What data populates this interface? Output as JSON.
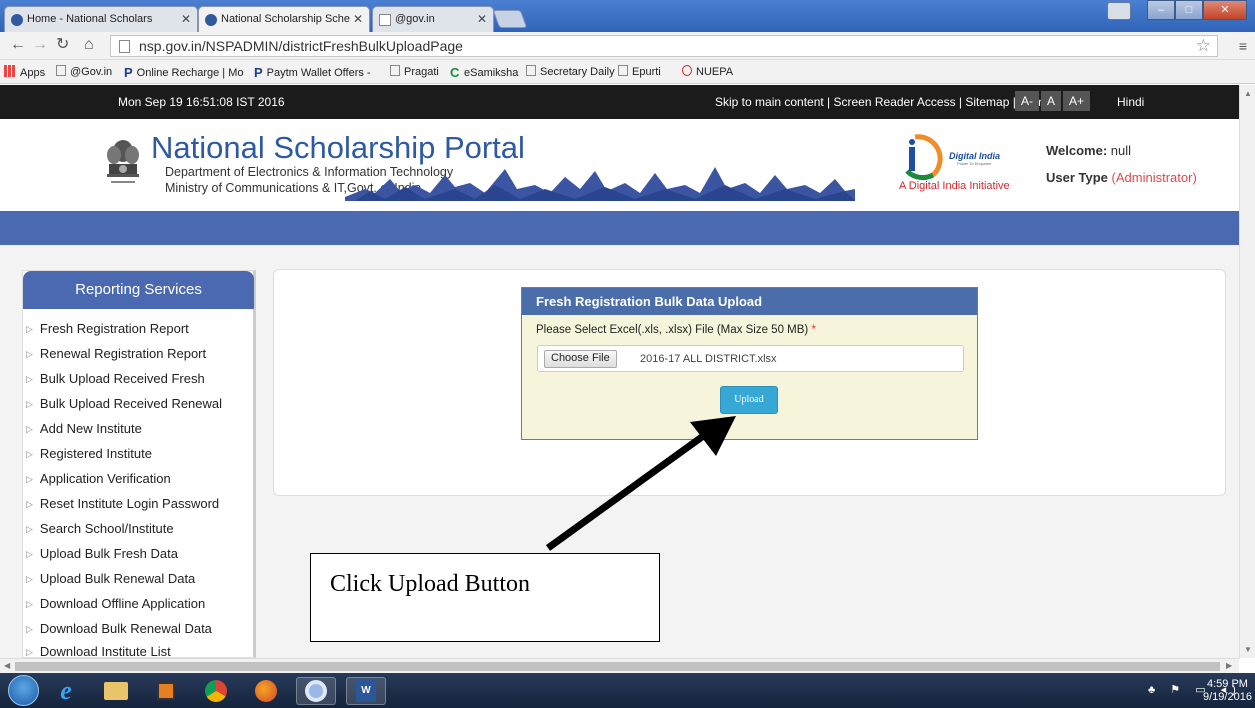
{
  "browser": {
    "tabs": [
      {
        "label": "Home - National Scholars",
        "active": false
      },
      {
        "label": "National Scholarship Sche",
        "active": true
      },
      {
        "label": "@gov.in",
        "active": false
      }
    ],
    "url": "nsp.gov.in/NSPADMIN/districtFreshBulkUploadPage",
    "bookmarks": [
      "Apps",
      "@Gov.in",
      "Online Recharge | Mo",
      "Paytm Wallet Offers -",
      "Pragati",
      "eSamiksha",
      "Secretary Daily",
      "Epurti",
      "NUEPA"
    ]
  },
  "topbar": {
    "datetime": "Mon Sep 19 16:51:08 IST 2016",
    "links": "Skip to main content | Screen Reader Access | Sitemap | Home |",
    "font_sizes": [
      "A-",
      "A",
      "A+"
    ],
    "language": "Hindi"
  },
  "header": {
    "title": "National Scholarship Portal",
    "dept_line1": "Department of Electronics & Information Technology",
    "dept_line2": "Ministry of Communications & IT,Govt. of India",
    "digital_india_tag": "A Digital India Initiative",
    "digital_india_logo": "Digital India",
    "digital_india_sub": "Power To Empower",
    "welcome_label": "Welcome:",
    "welcome_value": "null",
    "user_type_label": "User Type",
    "user_type_value": "(Administrator)"
  },
  "sidebar": {
    "title": "Reporting Services",
    "items": [
      "Fresh Registration Report",
      "Renewal Registration Report",
      "Bulk Upload Received Fresh",
      "Bulk Upload Received Renewal",
      "Add New Institute",
      "Registered Institute",
      "Application Verification",
      "Reset Institute Login Password",
      "Search School/Institute",
      "Upload Bulk Fresh Data",
      "Upload Bulk Renewal Data",
      "Download Offline Application",
      "Download Bulk Renewal Data",
      "Download Institute List"
    ]
  },
  "upload": {
    "title": "Fresh Registration Bulk Data Upload",
    "label": "Please Select Excel(.xls, .xlsx) File (Max Size 50 MB)",
    "required_mark": "*",
    "choose_label": "Choose File",
    "file_name": "2016-17 ALL DISTRICT.xlsx",
    "upload_label": "Upload"
  },
  "annotation": {
    "callout": "Click Upload Button"
  },
  "taskbar": {
    "time": "4:59 PM",
    "date": "9/19/2016"
  }
}
